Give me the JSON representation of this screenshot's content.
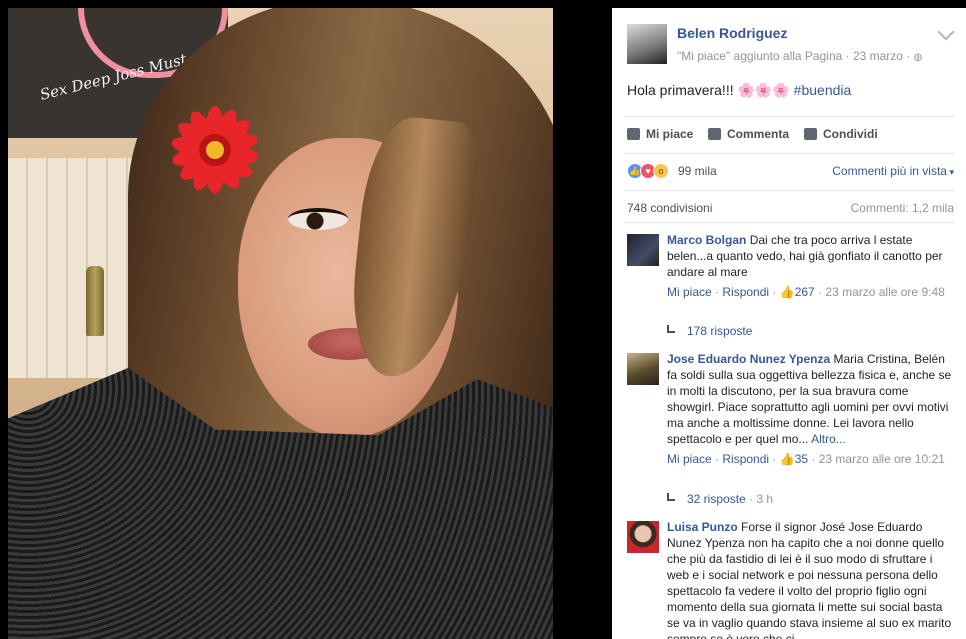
{
  "post": {
    "author": "Belen Rodriguez",
    "meta": "\"Mi piace\" aggiunto alla Pagina · 23 marzo · ",
    "text": "Hola primavera!!!",
    "emoji": "🌸🌸🌸",
    "hashtag": "#buendia",
    "photo_text": "Sex Deep Joss Must"
  },
  "actions": {
    "like": "Mi piace",
    "comment": "Commenta",
    "share": "Condividi"
  },
  "reactions": {
    "count": "99 mila",
    "sort_label": "Commenti più in vista",
    "shares": "748 condivisioni",
    "comments_count": "Commenti: 1,2 mila"
  },
  "comments": [
    {
      "name": "Marco Bolgan",
      "text": "Dai che tra poco arriva l estate belen...a quanto vedo, hai già gonfiato il canotto per andare al mare",
      "like": "Mi piace",
      "reply": "Rispondi",
      "likes": "267",
      "time": "23 marzo alle ore 9:48",
      "replies": "178 risposte",
      "replies_time": ""
    },
    {
      "name": "Jose Eduardo Nunez Ypenza",
      "text": "Maria Cristina, Belén fa soldi sulla sua oggettiva bellezza fisica e, anche se in molti la discutono, per la sua bravura come showgirl. Piace soprattutto agli uomini per ovvi motivi ma anche a moltissime donne. Lei lavora nello spettacolo e per quel mo...",
      "more": "Altro...",
      "like": "Mi piace",
      "reply": "Rispondi",
      "likes": "35",
      "time": "23 marzo alle ore 10:21",
      "replies": "32 risposte",
      "replies_time": " · 3 h"
    },
    {
      "name": "Luisa Punzo",
      "text": "Forse il signor José Jose Eduardo Nunez Ypenza non ha capito che a noi donne quello che più da fastidio di lei è il suo modo di sfruttare i web e i social network e poi nessuna persona dello spettacolo fa vedere il volto del proprio figlio ogni momento della sua giornata li mette sui social basta se va in vaglio quando stava insieme al suo ex marito sempre se è vero che ci"
    }
  ],
  "colors": {
    "link": "#365899",
    "muted": "#90949c",
    "text": "#1d2129"
  }
}
